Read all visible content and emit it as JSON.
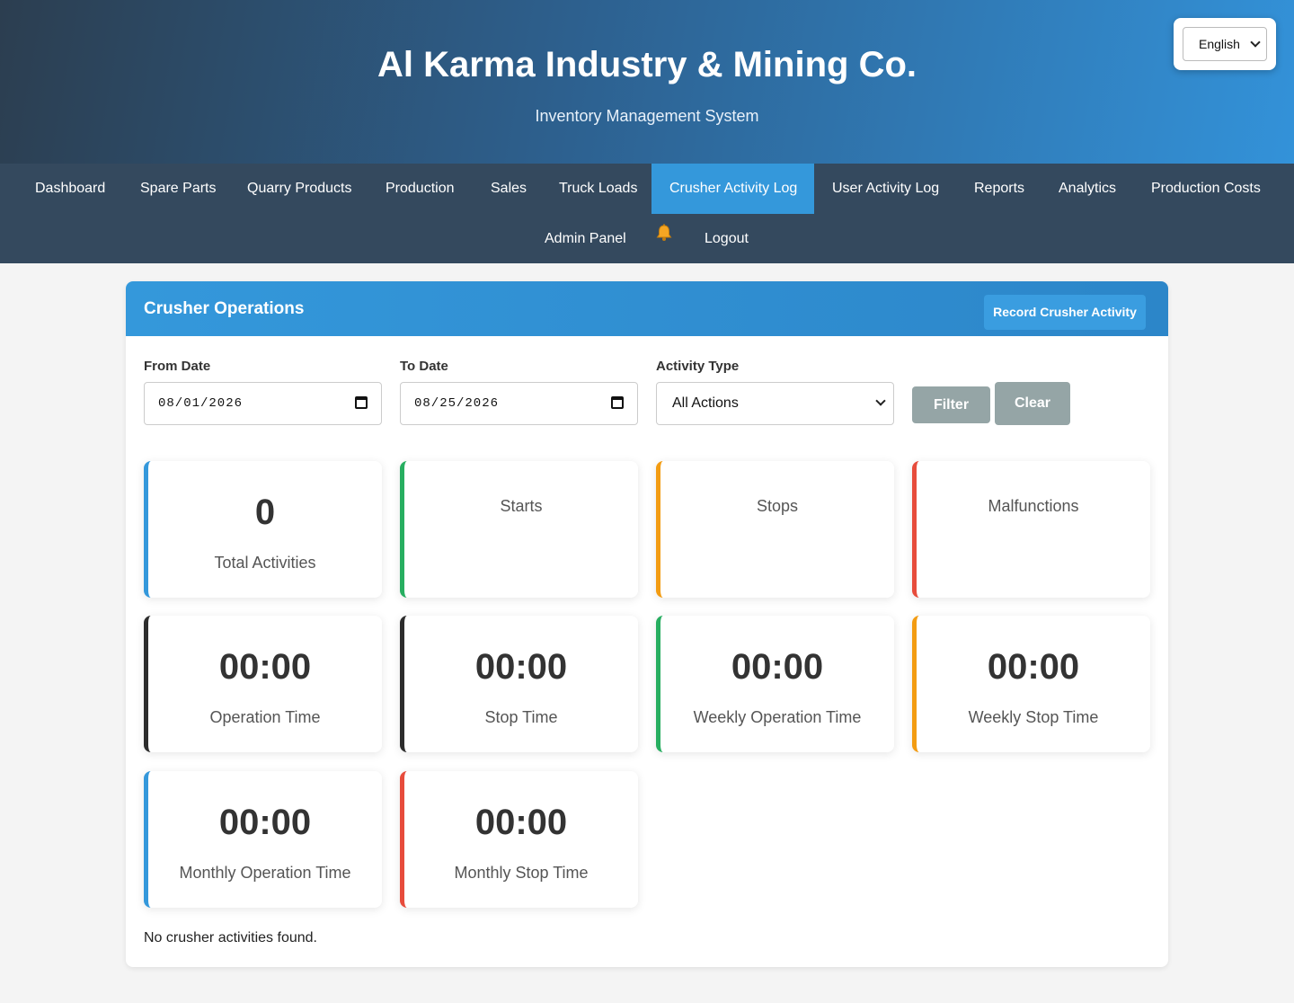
{
  "header": {
    "title": "Al Karma Industry & Mining Co.",
    "subtitle": "Inventory Management System",
    "language": "English"
  },
  "nav": {
    "items": [
      "Dashboard",
      "Spare Parts",
      "Quarry Products",
      "Production",
      "Sales",
      "Truck Loads",
      "Crusher Activity Log",
      "User Activity Log",
      "Reports",
      "Analytics",
      "Production Costs"
    ],
    "active": "Crusher Activity Log",
    "admin": "Admin Panel",
    "logout": "Logout",
    "bell_icon": "bell-icon"
  },
  "panel": {
    "title": "Crusher Operations",
    "record_button": "Record Crusher Activity"
  },
  "filters": {
    "from_label": "From Date",
    "from_value": "08/01/2026",
    "to_label": "To Date",
    "to_value": "08/25/2026",
    "type_label": "Activity Type",
    "type_value": "All Actions",
    "filter_button": "Filter",
    "clear_button": "Clear"
  },
  "stats": {
    "total": {
      "value": "0",
      "label": "Total Activities"
    },
    "starts": {
      "label": "Starts"
    },
    "stops": {
      "label": "Stops"
    },
    "malfunctions": {
      "label": "Malfunctions"
    },
    "operation_time": {
      "value": "00:00",
      "label": "Operation Time"
    },
    "stop_time": {
      "value": "00:00",
      "label": "Stop Time"
    },
    "weekly_operation_time": {
      "value": "00:00",
      "label": "Weekly Operation Time"
    },
    "weekly_stop_time": {
      "value": "00:00",
      "label": "Weekly Stop Time"
    },
    "monthly_operation_time": {
      "value": "00:00",
      "label": "Monthly Operation Time"
    },
    "monthly_stop_time": {
      "value": "00:00",
      "label": "Monthly Stop Time"
    }
  },
  "colors": {
    "blue": "#3498db",
    "green": "#27ae60",
    "orange": "#f39c12",
    "red": "#e74c3c",
    "dark": "#2c2c2c"
  },
  "empty_message": "No crusher activities found."
}
